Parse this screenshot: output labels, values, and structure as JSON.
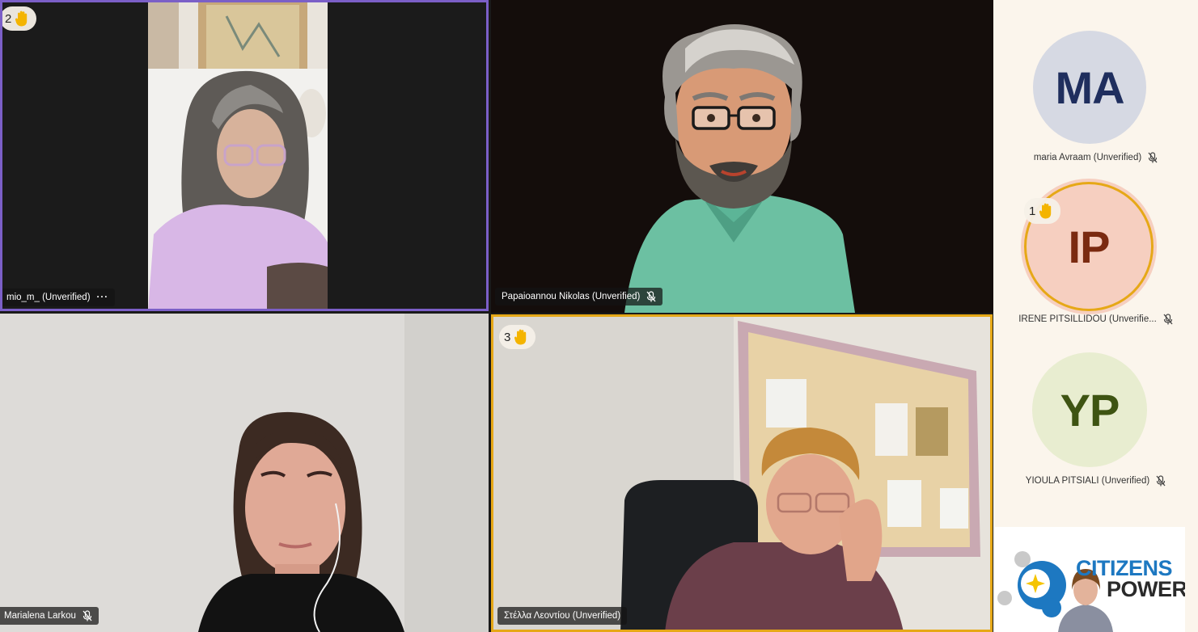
{
  "participants": [
    {
      "name": "mio_m_ (Unverified)",
      "raised_hand": "2",
      "more_label": "···"
    },
    {
      "name": "Papaioannou Nikolas (Unverified)"
    },
    {
      "name": "Marialena Larkou"
    },
    {
      "name": "Στέλλα Λεοντίου (Unverified)",
      "raised_hand": "3"
    }
  ],
  "sidebar": {
    "people": [
      {
        "initials": "MA",
        "name": "maria Avraam (Unverified)"
      },
      {
        "initials": "IP",
        "name": "IRENE PITSILLIDOU (Unverifie...",
        "raised_hand": "1"
      },
      {
        "initials": "YP",
        "name": "YIOULA PITSIALI (Unverified)"
      }
    ],
    "logo": {
      "line1": "CITIZENS",
      "line2": "POWER"
    }
  },
  "colors": {
    "active_speaker_border": "#7b5fc7",
    "raised_hand_border": "#e6a817",
    "hand": "#f4b400",
    "ma_avatar": "#d6d9e3",
    "ma_text": "#1f2e5e",
    "ip_avatar": "#f6cfc0",
    "ip_text": "#7a2a10",
    "yp_avatar": "#e8edd0",
    "yp_text": "#3e5412",
    "logo_blue": "#1d78c1"
  },
  "icons": [
    "raised-hand-icon",
    "mic-off-icon",
    "more-options-icon"
  ]
}
